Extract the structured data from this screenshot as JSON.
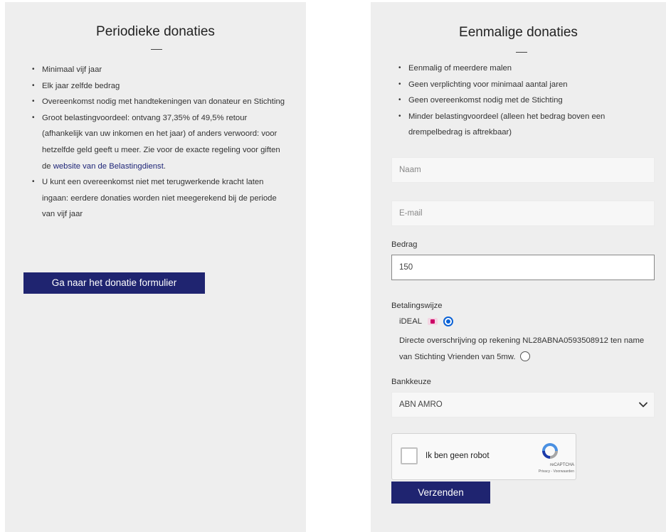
{
  "periodic": {
    "title": "Periodieke donaties",
    "bullets": [
      "Minimaal vijf jaar",
      "Elk jaar zelfde bedrag",
      "Overeenkomst nodig met handtekeningen van donateur en Stichting",
      "Groot belastingvoordeel: ontvang 37,35% of 49,5% retour (afhankelijk van uw inkomen en het jaar) of anders verwoord: voor hetzelfde geld geeft u meer. Zie voor de exacte regeling voor giften de",
      "U kunt een overeenkomst niet met terugwerkende kracht laten ingaan: eerdere donaties worden niet meegerekend bij de periode van vijf jaar"
    ],
    "link_text": "website van de Belastingdienst",
    "link_suffix": ".",
    "button_label": "Ga naar het donatie formulier"
  },
  "one_time": {
    "title": "Eenmalige donaties",
    "bullets": [
      "Eenmalig of meerdere malen",
      "Geen verplichting voor minimaal aantal jaren",
      "Geen overeenkomst nodig met de Stichting",
      "Minder belastingvoordeel (alleen het bedrag boven een drempelbedrag is aftrekbaar)"
    ]
  },
  "form": {
    "name_placeholder": "Naam",
    "email_placeholder": "E-mail",
    "amount_label": "Bedrag",
    "amount_value": "150",
    "payment_label": "Betalingswijze",
    "payment_options": [
      {
        "label": "iDEAL",
        "selected": true
      },
      {
        "label": "Directe overschrijving op rekening NL28ABNA0593508912 ten name van Stichting Vrienden van 5mw.",
        "selected": false
      }
    ],
    "bank_label": "Bankkeuze",
    "bank_value": "ABN AMRO",
    "captcha_label": "Ik ben geen robot",
    "captcha_brand": "reCAPTCHA",
    "captcha_links": "Privacy - Voorwaarden",
    "submit_label": "Verzenden"
  },
  "colors": {
    "panel_bg": "#eeeeee",
    "button_bg": "#1f2470",
    "link": "#1f2678",
    "radio_selected": "#0b62d6",
    "ideal_pink": "#cc0066"
  }
}
